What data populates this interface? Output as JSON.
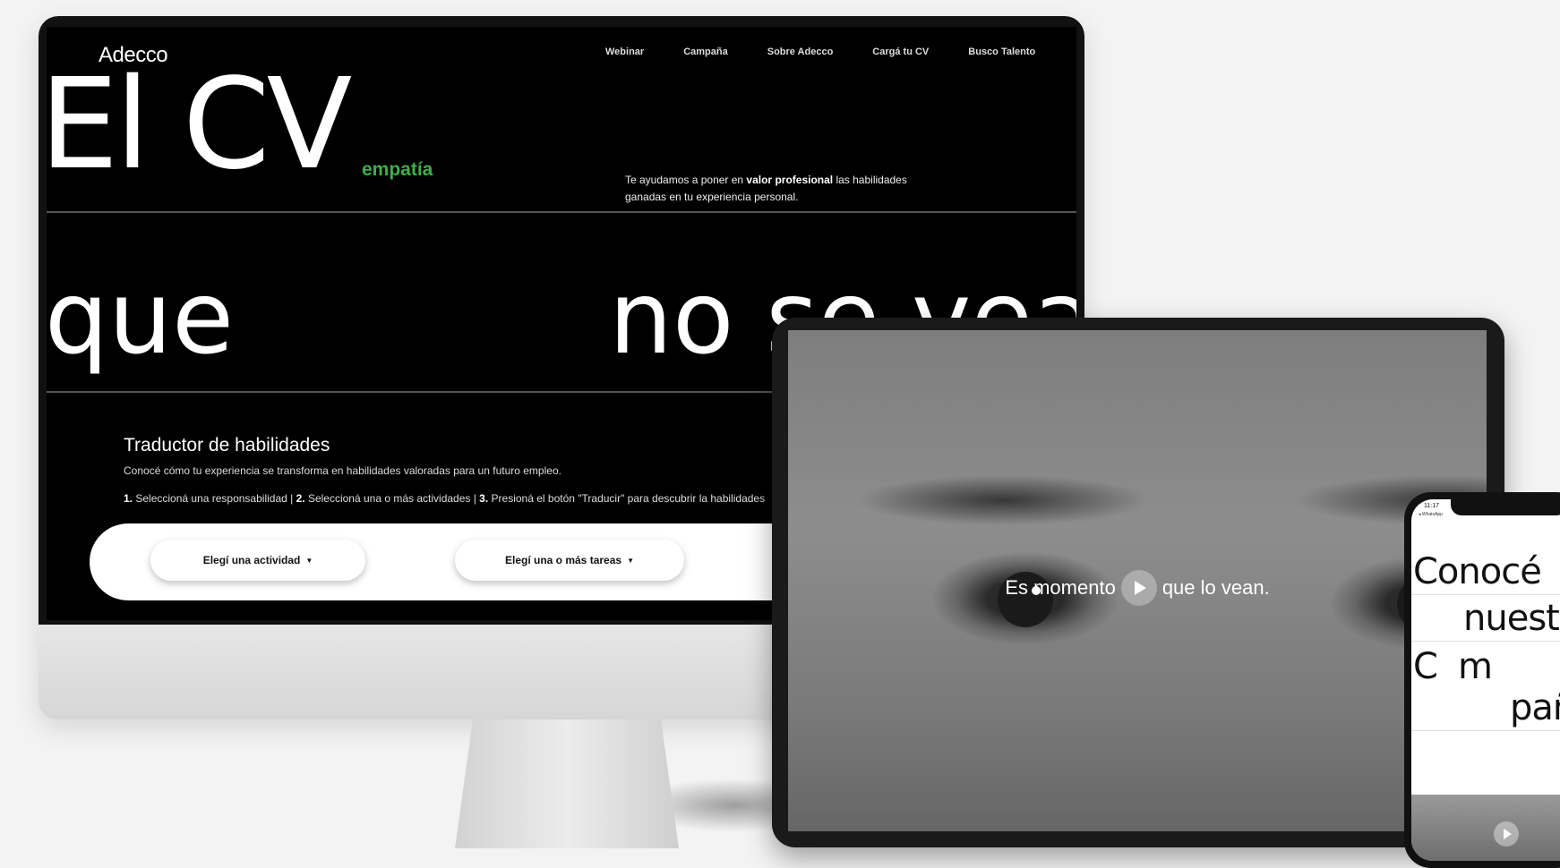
{
  "desktop": {
    "logo": "Adecco",
    "nav": [
      "Webinar",
      "Campaña",
      "Sobre Adecco",
      "Cargá tu CV",
      "Busco Talento"
    ],
    "hero": {
      "line1": "El CV",
      "accent_word": "empatía",
      "line2_left": "que",
      "line2_right": "no se vea",
      "description_pre": "Te ayudamos a poner en ",
      "description_bold": "valor profesional",
      "description_post": " las habilidades ganadas en tu experiencia personal."
    },
    "translator": {
      "title": "Traductor de habilidades",
      "subtitle": "Conocé cómo tu experiencia se transforma en habilidades valoradas para un futuro empleo.",
      "step1_num": "1.",
      "step1_text": " Seleccioná una responsabilidad | ",
      "step2_num": "2.",
      "step2_text": " Seleccioná una o más actividades | ",
      "step3_num": "3.",
      "step3_text": " Presioná el botón \"Traducir\" para descubrir la habilidades",
      "dropdown_activity": "Elegí una actividad",
      "dropdown_tasks": "Elegí una o más tareas"
    },
    "colors": {
      "accent_green": "#3fae49",
      "background": "#000000"
    }
  },
  "tablet": {
    "caption_left": "Es momento",
    "caption_right": "que lo vean.",
    "play_icon": "play-icon"
  },
  "phone": {
    "status_time": "11:17",
    "status_app": "◂ WhatsApp",
    "line1": "Conocé",
    "line2": "nuestr",
    "line3a": "C",
    "line3b": "m",
    "line4": "pañ"
  }
}
